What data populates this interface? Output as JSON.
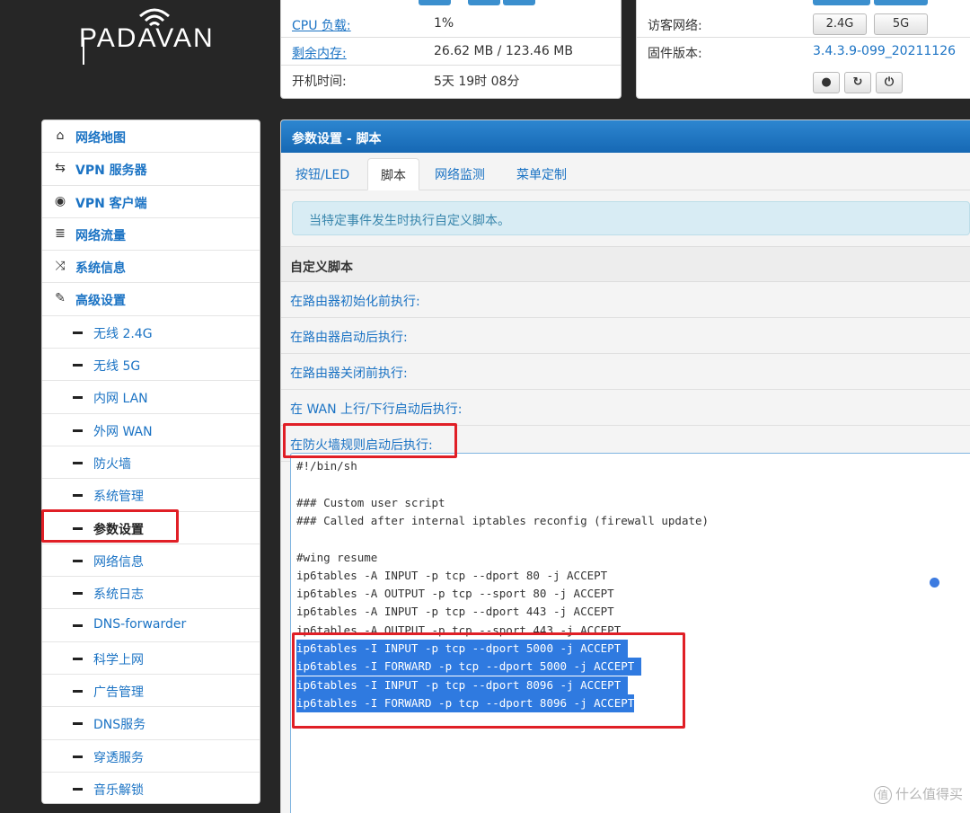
{
  "logo": {
    "text": "PADAVAN"
  },
  "status_left": [
    {
      "key": "CPU 负载:",
      "value": "1%"
    },
    {
      "key": "剩余内存:",
      "value": "26.62 MB / 123.46 MB"
    },
    {
      "key": "开机时间:",
      "value": "5天 19时 08分"
    }
  ],
  "status_right": {
    "guest_label": "访客网络:",
    "guest_buttons": [
      "2.4G",
      "5G"
    ],
    "firmware_label": "固件版本:",
    "firmware_value": "3.4.3.9-099_20211126",
    "action_icons": [
      "user-icon",
      "refresh-icon",
      "power-icon"
    ]
  },
  "sidebar": {
    "main_items": [
      {
        "label": "网络地图",
        "icon": "home-icon",
        "glyph": "⌂"
      },
      {
        "label": "VPN 服务器",
        "icon": "vpn-server-icon",
        "glyph": "⇆"
      },
      {
        "label": "VPN 客户端",
        "icon": "globe-icon",
        "glyph": "◉"
      },
      {
        "label": "网络流量",
        "icon": "list-icon",
        "glyph": "≣"
      },
      {
        "label": "系统信息",
        "icon": "shuffle-icon",
        "glyph": "⤨"
      },
      {
        "label": "高级设置",
        "icon": "wrench-icon",
        "glyph": "✎"
      }
    ],
    "sub_items": [
      {
        "label": "无线 2.4G"
      },
      {
        "label": "无线 5G"
      },
      {
        "label": "内网 LAN"
      },
      {
        "label": "外网 WAN"
      },
      {
        "label": "防火墙"
      },
      {
        "label": "系统管理"
      },
      {
        "label": "参数设置",
        "active": true
      },
      {
        "label": "网络信息"
      },
      {
        "label": "系统日志"
      },
      {
        "label": "DNS-forwarder"
      },
      {
        "label": "科学上网"
      },
      {
        "label": "广告管理"
      },
      {
        "label": "DNS服务"
      },
      {
        "label": "穿透服务"
      },
      {
        "label": "音乐解锁"
      }
    ]
  },
  "main": {
    "header": "参数设置 - 脚本",
    "tabs": [
      {
        "label": "按钮/LED"
      },
      {
        "label": "脚本",
        "active": true
      },
      {
        "label": "网络监测"
      },
      {
        "label": "菜单定制"
      }
    ],
    "info": "当特定事件发生时执行自定义脚本。",
    "section_title": "自定义脚本",
    "script_rows": [
      "在路由器初始化前执行:",
      "在路由器启动后执行:",
      "在路由器关闭前执行:",
      "在 WAN 上行/下行启动后执行:",
      "在防火墙规则启动后执行:"
    ],
    "code_lines": [
      {
        "text": "#!/bin/sh",
        "selected": false
      },
      {
        "text": "",
        "selected": false
      },
      {
        "text": "### Custom user script",
        "selected": false
      },
      {
        "text": "### Called after internal iptables reconfig (firewall update)",
        "selected": false
      },
      {
        "text": "",
        "selected": false
      },
      {
        "text": "#wing resume",
        "selected": false
      },
      {
        "text": "ip6tables -A INPUT -p tcp --dport 80 -j ACCEPT",
        "selected": false
      },
      {
        "text": "ip6tables -A OUTPUT -p tcp --sport 80 -j ACCEPT",
        "selected": false
      },
      {
        "text": "ip6tables -A INPUT -p tcp --dport 443 -j ACCEPT",
        "selected": false
      },
      {
        "text": "ip6tables -A OUTPUT -p tcp --sport 443 -j ACCEPT",
        "selected": false
      },
      {
        "text": "ip6tables -I INPUT -p tcp --dport 5000 -j ACCEPT ",
        "selected": true
      },
      {
        "text": "ip6tables -I FORWARD -p tcp --dport 5000 -j ACCEPT ",
        "selected": true
      },
      {
        "text": "ip6tables -I INPUT -p tcp --dport 8096 -j ACCEPT ",
        "selected": true
      },
      {
        "text": "ip6tables -I FORWARD -p tcp --dport 8096 -j ACCEPT",
        "selected": true
      }
    ]
  },
  "watermark": {
    "glyph": "值",
    "text": "什么值得买"
  },
  "colors": {
    "accent": "#1b73c4",
    "header": "#1668b4",
    "highlight": "#e01f26",
    "selection": "#2f7ae0"
  }
}
